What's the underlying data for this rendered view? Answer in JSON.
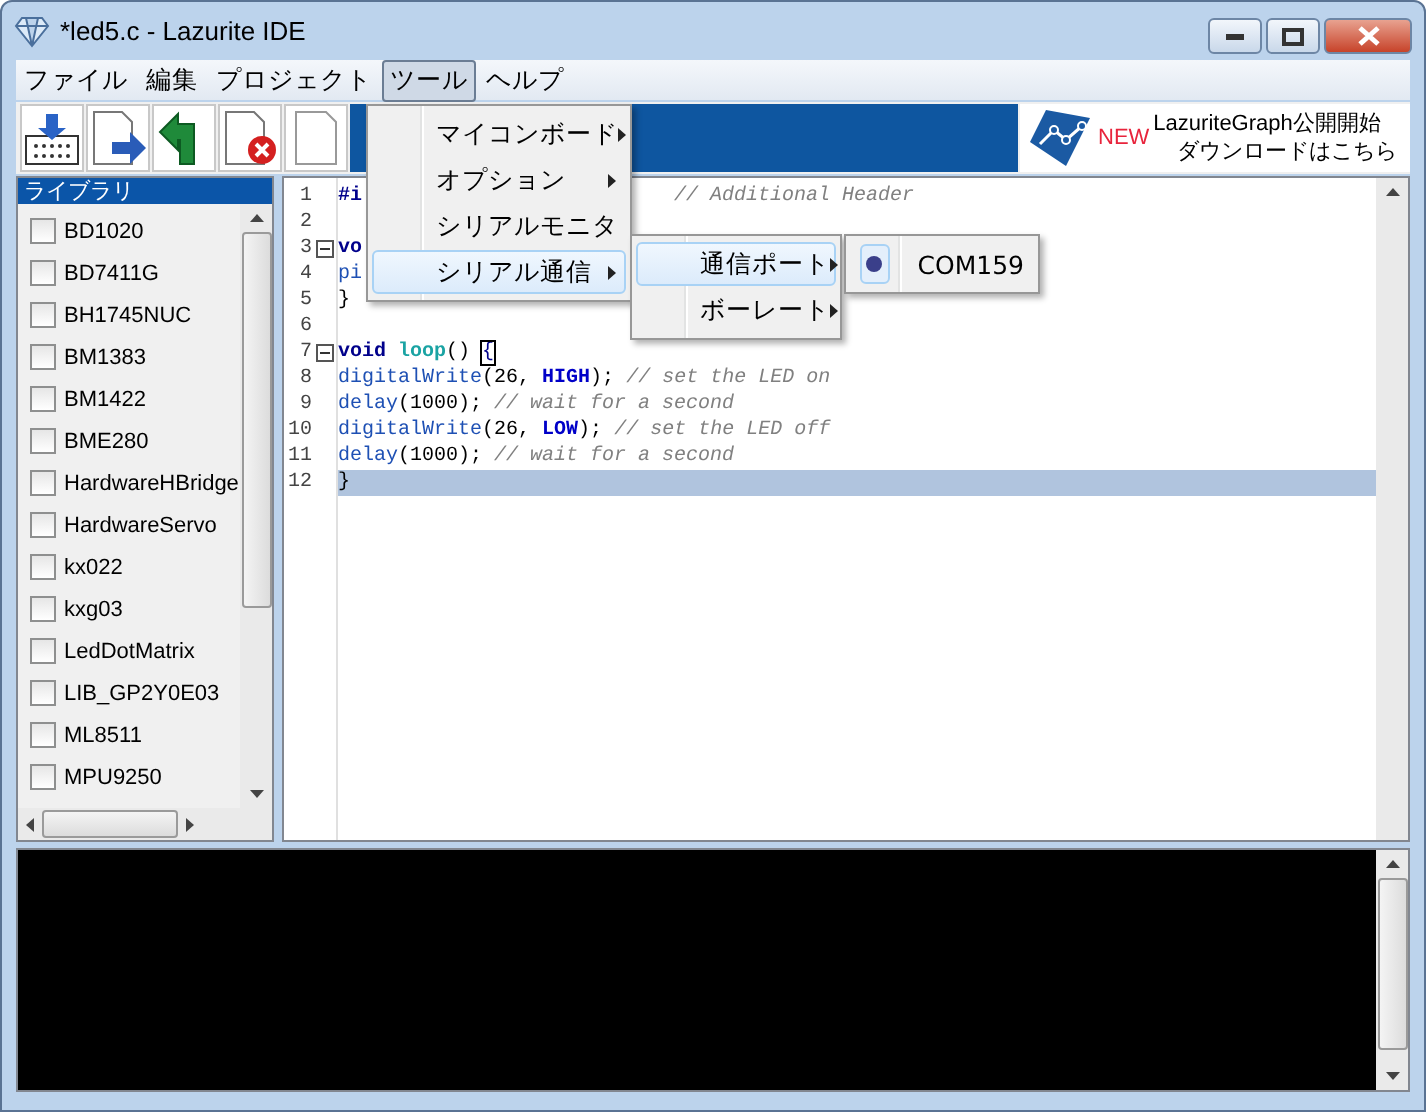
{
  "window": {
    "title": "*led5.c - Lazurite IDE"
  },
  "menu_bar": [
    {
      "label": "ファイル",
      "selected": false
    },
    {
      "label": "編集",
      "selected": false
    },
    {
      "label": "プロジェクト",
      "selected": false
    },
    {
      "label": "ツール",
      "selected": true
    },
    {
      "label": "ヘルプ",
      "selected": false
    }
  ],
  "banner": {
    "badge": "NEW",
    "line_1": "LazuriteGraph公開開始",
    "line_2": "ダウンロードはこちら"
  },
  "library": {
    "title": "ライブラリ",
    "items": [
      {
        "label": "BD1020",
        "checked": false
      },
      {
        "label": "BD7411G",
        "checked": false
      },
      {
        "label": "BH1745NUC",
        "checked": false
      },
      {
        "label": "BM1383",
        "checked": false
      },
      {
        "label": "BM1422",
        "checked": false
      },
      {
        "label": "BME280",
        "checked": false
      },
      {
        "label": "HardwareHBridge",
        "checked": false
      },
      {
        "label": "HardwareServo",
        "checked": false
      },
      {
        "label": "kx022",
        "checked": false
      },
      {
        "label": "kxg03",
        "checked": false
      },
      {
        "label": "LedDotMatrix",
        "checked": false
      },
      {
        "label": "LIB_GP2Y0E03",
        "checked": false
      },
      {
        "label": "ML8511",
        "checked": false
      },
      {
        "label": "MPU9250",
        "checked": false
      }
    ]
  },
  "editor": {
    "lines": [
      {
        "number": "1",
        "fold": false,
        "highlighted": false,
        "tokens": [
          {
            "kind": "keyword",
            "text": "#i"
          },
          {
            "kind": "gap"
          },
          {
            "kind": "comment",
            "text": "// Additional Header"
          }
        ]
      },
      {
        "number": "2",
        "fold": false,
        "highlighted": false
      },
      {
        "number": "3",
        "fold": true,
        "highlighted": false,
        "tokens": [
          {
            "kind": "keyword",
            "text": "vo"
          }
        ]
      },
      {
        "number": "4",
        "fold": false,
        "highlighted": false,
        "tokens": [
          {
            "kind": "call",
            "text": "pi"
          }
        ]
      },
      {
        "number": "5",
        "fold": false,
        "highlighted": false,
        "tokens": [
          {
            "kind": "plain",
            "text": "}"
          }
        ]
      },
      {
        "number": "6",
        "fold": false,
        "highlighted": false
      },
      {
        "number": "7",
        "fold": true,
        "highlighted": false,
        "tokens": [
          {
            "kind": "keyword",
            "text": "void "
          },
          {
            "kind": "func",
            "text": "loop"
          },
          {
            "kind": "plain",
            "text": "() "
          },
          {
            "kind": "match",
            "text": "{"
          }
        ]
      },
      {
        "number": "8",
        "fold": false,
        "highlighted": false,
        "tokens": [
          {
            "kind": "call",
            "text": "digitalWrite"
          },
          {
            "kind": "plain",
            "text": "(26, "
          },
          {
            "kind": "const",
            "text": "HIGH"
          },
          {
            "kind": "plain",
            "text": "); "
          },
          {
            "kind": "comment",
            "text": "// set the LED on"
          }
        ]
      },
      {
        "number": "9",
        "fold": false,
        "highlighted": false,
        "tokens": [
          {
            "kind": "call",
            "text": "delay"
          },
          {
            "kind": "plain",
            "text": "(1000); "
          },
          {
            "kind": "comment",
            "text": "// wait for a second"
          }
        ]
      },
      {
        "number": "10",
        "fold": false,
        "highlighted": false,
        "tokens": [
          {
            "kind": "call",
            "text": "digitalWrite"
          },
          {
            "kind": "plain",
            "text": "(26, "
          },
          {
            "kind": "const",
            "text": "LOW"
          },
          {
            "kind": "plain",
            "text": "); "
          },
          {
            "kind": "comment",
            "text": "// set the LED off"
          }
        ]
      },
      {
        "number": "11",
        "fold": false,
        "highlighted": false,
        "tokens": [
          {
            "kind": "call",
            "text": "delay"
          },
          {
            "kind": "plain",
            "text": "(1000); "
          },
          {
            "kind": "comment",
            "text": "// wait for a second"
          }
        ]
      },
      {
        "number": "12",
        "fold": false,
        "highlighted": true,
        "tokens": [
          {
            "kind": "plain",
            "text": "}"
          }
        ]
      }
    ]
  },
  "tools_menu": [
    {
      "label": "マイコンボード",
      "submenu": true,
      "selected": false
    },
    {
      "label": "オプション",
      "submenu": true,
      "selected": false
    },
    {
      "label": "シリアルモニタ",
      "submenu": false,
      "selected": false
    },
    {
      "label": "シリアル通信",
      "submenu": true,
      "selected": true
    }
  ],
  "serial_menu": [
    {
      "label": "通信ポート",
      "submenu": true,
      "selected": true
    },
    {
      "label": "ボーレート",
      "submenu": true,
      "selected": false
    }
  ],
  "port_menu": [
    {
      "label": "COM159",
      "selected": true
    }
  ]
}
